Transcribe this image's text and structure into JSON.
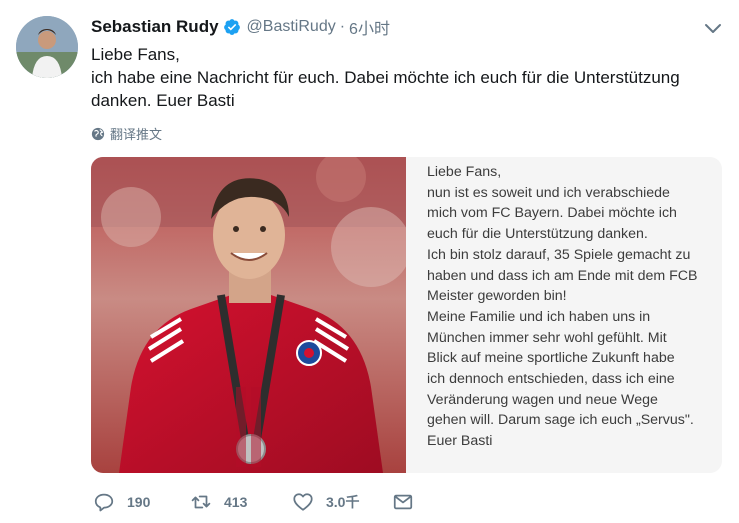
{
  "author": {
    "display_name": "Sebastian Rudy",
    "handle": "@BastiRudy",
    "separator": "·",
    "time": "6小时"
  },
  "tweet_lines": [
    "Liebe Fans,",
    "ich habe eine Nachricht für euch. Dabei möchte ich euch für die Unterstützung",
    "danken. Euer Basti"
  ],
  "translate_label": "翻译推文",
  "statement_lines": [
    "Liebe Fans,",
    "nun ist es soweit und ich verabschiede",
    "mich vom FC Bayern. Dabei möchte ich",
    "euch für die Unterstützung danken.",
    "Ich bin stolz darauf, 35 Spiele gemacht zu",
    "haben und dass ich am Ende mit dem FCB",
    "Meister geworden bin!",
    "Meine Familie und ich haben uns in",
    "München immer sehr wohl gefühlt. Mit",
    "Blick auf meine sportliche Zukunft habe",
    "ich dennoch entschieden, dass ich eine",
    "Veränderung wagen und neue Wege",
    "gehen will. Darum sage ich euch „Servus\".",
    "Euer Basti"
  ],
  "actions": {
    "replies": "190",
    "retweets": "413",
    "likes": "3.0千"
  },
  "icons": {
    "verified": "verified-badge-icon",
    "caret": "chevron-down-icon",
    "globe": "globe-icon",
    "reply": "reply-icon",
    "retweet": "retweet-icon",
    "like": "heart-icon",
    "dm": "envelope-icon"
  },
  "colors": {
    "text_primary": "#14171a",
    "text_secondary": "#657786",
    "verified_blue": "#1da1f2",
    "jersey_red": "#c8102e"
  }
}
